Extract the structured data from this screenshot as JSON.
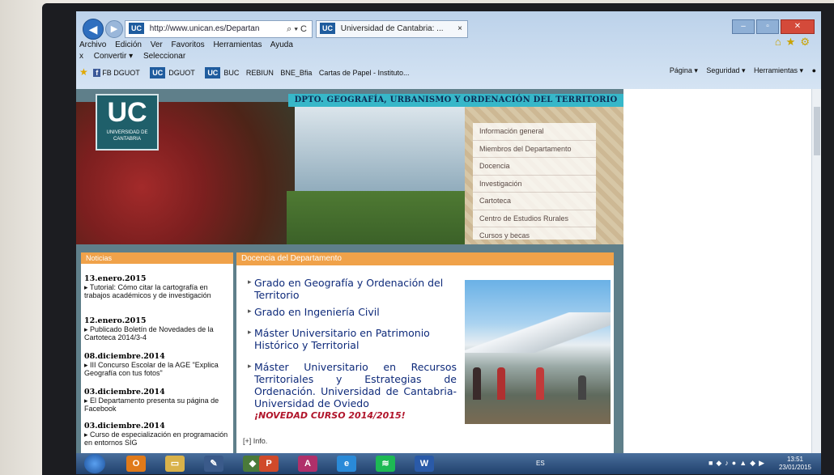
{
  "browser": {
    "url": "http://www.unican.es/Departan",
    "tab_title": "Universidad de Cantabria: ...",
    "tab_close": "×",
    "address_controls": "⌕ ▾ C",
    "menu": [
      "Archivo",
      "Edición",
      "Ver",
      "Favoritos",
      "Herramientas",
      "Ayuda"
    ],
    "convert_row": [
      "x",
      "Convertir ▾",
      "Seleccionar"
    ],
    "favorites": [
      "FB DGUOT",
      "DGUOT",
      "BUC",
      "REBIUN",
      "BNE_Bfia",
      "Cartas de Papel - Instituto..."
    ],
    "tools": [
      "Página ▾",
      "Seguridad ▾",
      "Herramientas ▾"
    ]
  },
  "site": {
    "logo": "UC",
    "logo_sub": "UNIVERSIDAD DE CANTABRIA",
    "department": "DPTO. GEOGRAFÍA, URBANISMO Y ORDENACIÓN DEL TERRITORIO",
    "nav": [
      "Información general",
      "Miembros del Departamento",
      "Docencia",
      "Investigación",
      "Cartoteca",
      "Centro de Estudios Rurales",
      "Cursos y becas"
    ]
  },
  "news": {
    "title": "Noticias",
    "items": [
      {
        "date": "13.enero.2015",
        "text": "Tutorial: Cómo citar la cartografía en trabajos académicos y de investigación"
      },
      {
        "date": "12.enero.2015",
        "text": "Publicado Boletín de Novedades de la Cartoteca 2014/3-4"
      },
      {
        "date": "08.diciembre.2014",
        "text": "III Concurso Escolar de la AGE \"Explica Geografía con tus fotos\""
      },
      {
        "date": "03.diciembre.2014",
        "text": "El Departamento presenta su página de Facebook"
      },
      {
        "date": "03.diciembre.2014",
        "text": "Curso de especialización en programación en entornos SIG"
      }
    ]
  },
  "docencia": {
    "title": "Docencia del Departamento",
    "courses": [
      "Grado en Geografía y Ordenación del Territorio",
      "Grado en Ingeniería Civil",
      "Máster Universitario en Patrimonio Histórico y Territorial",
      "Máster Universitario en Recursos Territoriales y Estrategias de Ordenación. Universidad de Cantabria-Universidad de Oviedo"
    ],
    "novedad": "¡NOVEDAD CURSO 2014/2015!",
    "info": "[+] Info."
  },
  "taskbar": {
    "lang": "ES",
    "time": "13:51",
    "date": "23/01/2015"
  }
}
